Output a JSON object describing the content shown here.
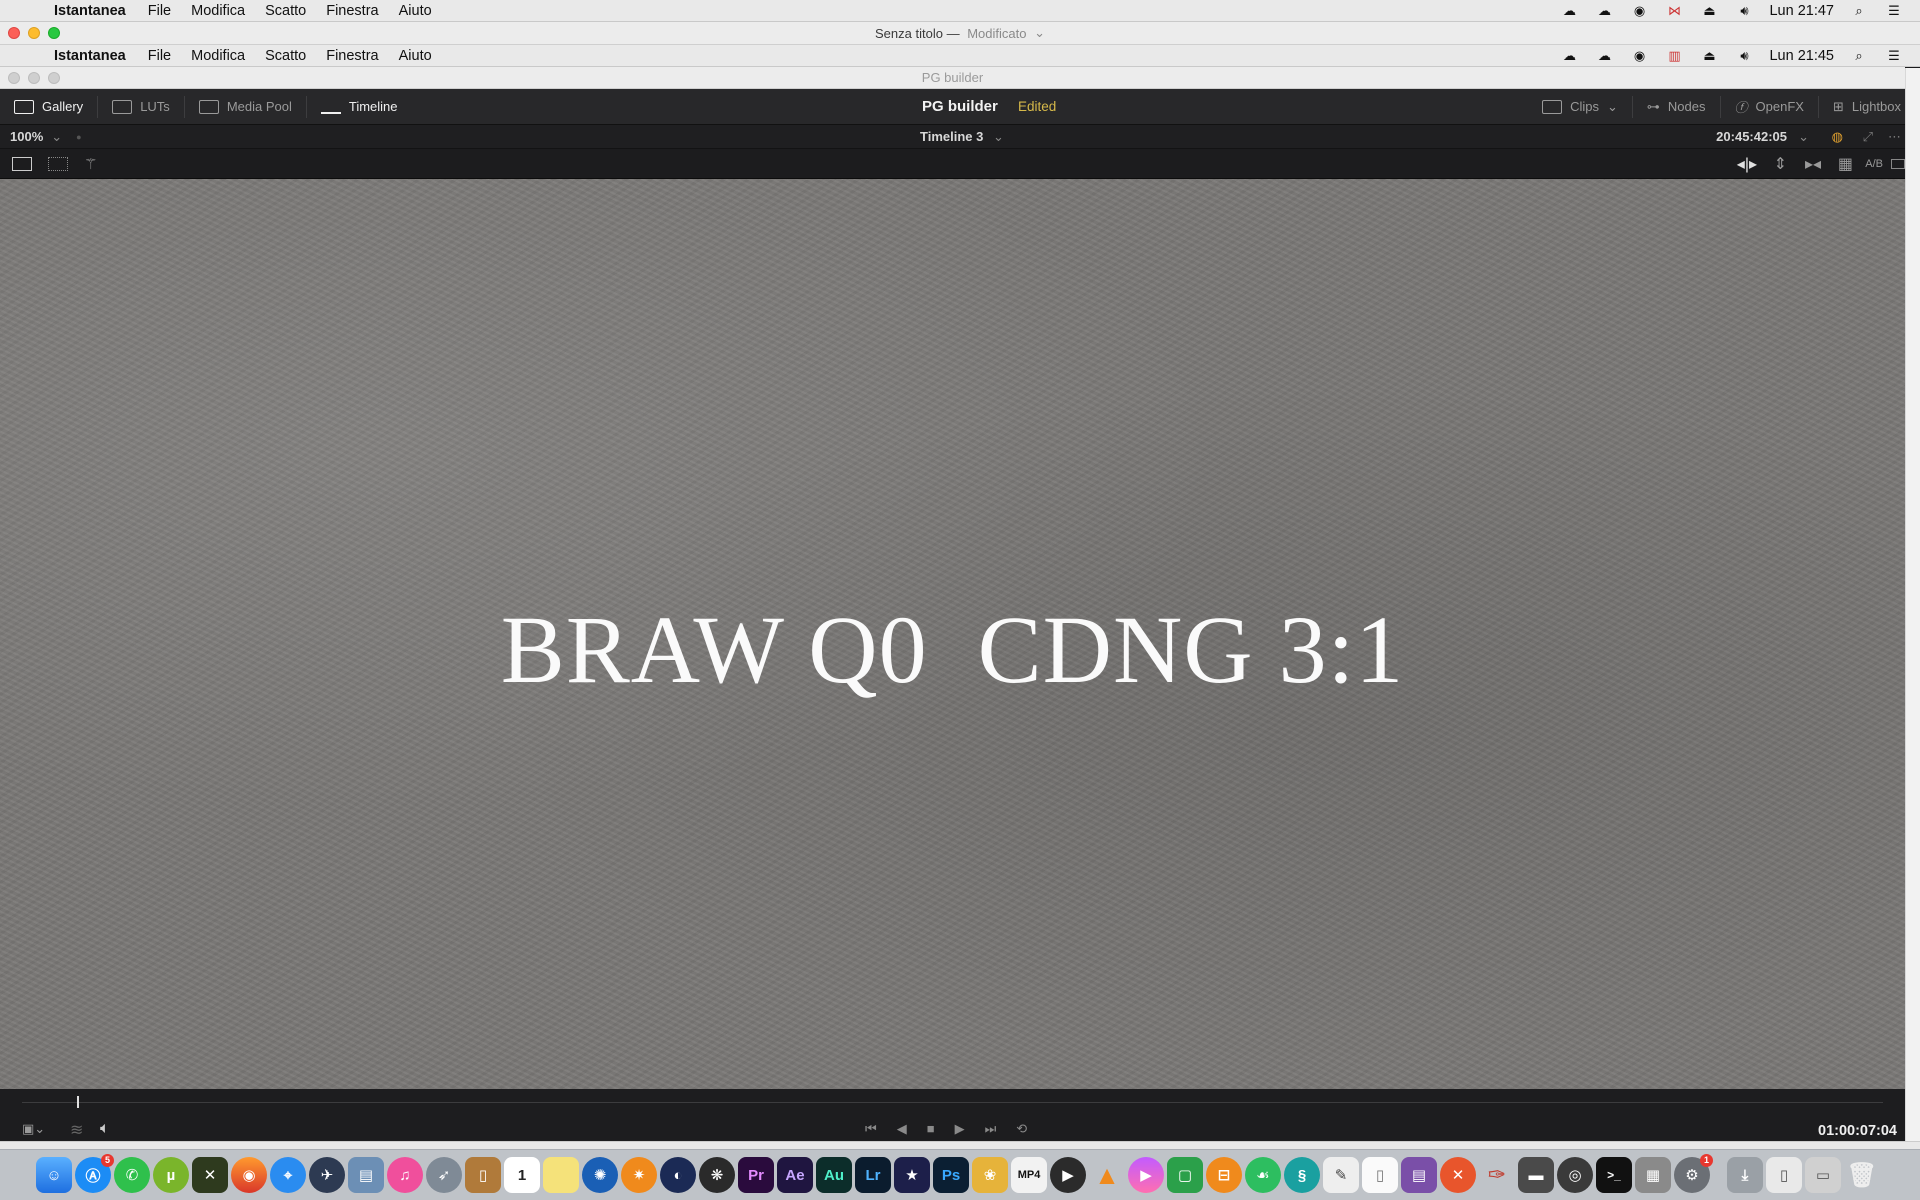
{
  "menubar_outer": {
    "app": "Istantanea",
    "items": [
      "File",
      "Modifica",
      "Scatto",
      "Finestra",
      "Aiuto"
    ],
    "clock": "Lun 21:47"
  },
  "window": {
    "title": "Senza titolo",
    "separator": "—",
    "status": "Modificato",
    "chevron": "⌄"
  },
  "menubar_inner": {
    "app": "Istantanea",
    "items": [
      "File",
      "Modifica",
      "Scatto",
      "Finestra",
      "Aiuto"
    ],
    "clock": "Lun 21:45"
  },
  "inner_window": {
    "title": "PG builder"
  },
  "resolve": {
    "tabs": {
      "gallery": "Gallery",
      "luts": "LUTs",
      "media_pool": "Media Pool",
      "timeline": "Timeline"
    },
    "project": "PG builder",
    "edited": "Edited",
    "right_tabs": {
      "clips": "Clips",
      "nodes": "Nodes",
      "openfx": "OpenFX",
      "lightbox": "Lightbox"
    },
    "zoom": "100%",
    "timeline_name": "Timeline 3",
    "source_timecode": "20:45:42:05",
    "ab_label": "A/B",
    "overlay_text": "BRAW Q0  CDNG 3:1",
    "record_timecode": "01:00:07:04"
  },
  "colors": {
    "accent_edited": "#d6b94a",
    "viewer_bg": "#777573"
  },
  "dock": {
    "icons": [
      "finder-icon",
      "app-store-icon",
      "whatsapp-icon",
      "utorrent-icon",
      "maps-icon",
      "firefox-icon",
      "safari-icon",
      "rocket-icon",
      "photos-icon",
      "itunes-icon",
      "launchpad-icon",
      "books-icon",
      "calendar-icon",
      "notes-icon",
      "davinci-icon",
      "blender-icon",
      "cinema4d-icon",
      "resolve-icon",
      "premiere-icon",
      "aftereffects-icon",
      "audition-icon",
      "lightroom-icon",
      "imovie-icon",
      "photoshop-icon",
      "sketch-icon",
      "mp4-icon",
      "player-icon",
      "vlc-icon",
      "infuse-icon",
      "camtasia-icon",
      "ibooks-icon",
      "evernote-icon",
      "shazam-icon",
      "texteditor-icon",
      "file-icon",
      "rar-icon",
      "xmind-icon",
      "pencil-icon",
      "scanner-icon",
      "disk-icon",
      "terminal-icon",
      "archive-icon",
      "settings-icon",
      "trash-icon"
    ],
    "labels": {
      "appstore_badge": "5",
      "premiere": "Pr",
      "aftereffects": "Ae",
      "audition": "Au",
      "lightroom": "Lr",
      "photoshop": "Ps",
      "mp4": "MP4",
      "calendar": "1",
      "settings_badge": "1"
    }
  }
}
